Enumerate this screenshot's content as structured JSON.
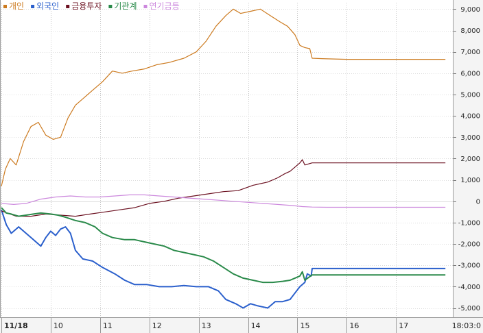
{
  "chart_data": {
    "type": "line",
    "legend": {
      "placement": "top-left",
      "entries": [
        {
          "name": "개인",
          "color": "#cc7a1f"
        },
        {
          "name": "외국인",
          "color": "#2a5fcc"
        },
        {
          "name": "금융투자",
          "color": "#6b1020"
        },
        {
          "name": "기관계",
          "color": "#2a8a4a"
        },
        {
          "name": "연기금등",
          "color": "#cc88dd"
        }
      ]
    },
    "yaxis": {
      "position": "right",
      "ylim": [
        -5400,
        9300
      ],
      "ticks": [
        9000,
        8000,
        7000,
        6000,
        5000,
        4000,
        3000,
        2000,
        1000,
        0,
        -1000,
        -2000,
        -3000,
        -4000,
        -5000
      ],
      "tick_labels": [
        "9,000",
        "8,000",
        "7,000",
        "6,000",
        "5,000",
        "4,000",
        "3,000",
        "2,000",
        "1,000",
        "0",
        "-1,000",
        "-2,000",
        "-3,000",
        "-4,000",
        "-5,000"
      ]
    },
    "xaxis": {
      "categories": [
        "11/18",
        "10",
        "11",
        "12",
        "13",
        "14",
        "15",
        "16",
        "17"
      ],
      "range": [
        0,
        9.15
      ],
      "time_label": "18:03:0"
    },
    "grid": true,
    "series": [
      {
        "name": "개인",
        "color": "#cc7a1f",
        "points": [
          [
            0,
            700
          ],
          [
            0.08,
            1500
          ],
          [
            0.18,
            2000
          ],
          [
            0.3,
            1700
          ],
          [
            0.45,
            2800
          ],
          [
            0.6,
            3500
          ],
          [
            0.75,
            3700
          ],
          [
            0.9,
            3100
          ],
          [
            1.05,
            2900
          ],
          [
            1.2,
            3000
          ],
          [
            1.35,
            3900
          ],
          [
            1.5,
            4500
          ],
          [
            1.65,
            4800
          ],
          [
            1.85,
            5200
          ],
          [
            2.05,
            5600
          ],
          [
            2.25,
            6100
          ],
          [
            2.45,
            6000
          ],
          [
            2.65,
            6100
          ],
          [
            2.9,
            6200
          ],
          [
            3.15,
            6400
          ],
          [
            3.4,
            6500
          ],
          [
            3.7,
            6700
          ],
          [
            3.95,
            7000
          ],
          [
            4.15,
            7500
          ],
          [
            4.35,
            8200
          ],
          [
            4.55,
            8700
          ],
          [
            4.7,
            9000
          ],
          [
            4.85,
            8800
          ],
          [
            5.05,
            8900
          ],
          [
            5.25,
            9000
          ],
          [
            5.45,
            8700
          ],
          [
            5.65,
            8400
          ],
          [
            5.8,
            8200
          ],
          [
            5.95,
            7800
          ],
          [
            6.05,
            7300
          ],
          [
            6.15,
            7200
          ],
          [
            6.25,
            7150
          ],
          [
            6.3,
            6700
          ],
          [
            6.5,
            6680
          ],
          [
            7.0,
            6650
          ],
          [
            8.0,
            6650
          ],
          [
            9.0,
            6650
          ]
        ]
      },
      {
        "name": "외국인",
        "color": "#2a5fcc",
        "points": [
          [
            0,
            -400
          ],
          [
            0.1,
            -1100
          ],
          [
            0.2,
            -1500
          ],
          [
            0.35,
            -1200
          ],
          [
            0.5,
            -1500
          ],
          [
            0.65,
            -1800
          ],
          [
            0.8,
            -2100
          ],
          [
            0.9,
            -1700
          ],
          [
            1.0,
            -1400
          ],
          [
            1.1,
            -1600
          ],
          [
            1.2,
            -1300
          ],
          [
            1.3,
            -1200
          ],
          [
            1.4,
            -1500
          ],
          [
            1.5,
            -2300
          ],
          [
            1.65,
            -2700
          ],
          [
            1.85,
            -2800
          ],
          [
            2.05,
            -3100
          ],
          [
            2.3,
            -3400
          ],
          [
            2.5,
            -3700
          ],
          [
            2.7,
            -3900
          ],
          [
            2.95,
            -3900
          ],
          [
            3.2,
            -4000
          ],
          [
            3.45,
            -4000
          ],
          [
            3.7,
            -3950
          ],
          [
            3.95,
            -4000
          ],
          [
            4.2,
            -4000
          ],
          [
            4.4,
            -4200
          ],
          [
            4.55,
            -4600
          ],
          [
            4.75,
            -4800
          ],
          [
            4.9,
            -5000
          ],
          [
            5.05,
            -4800
          ],
          [
            5.2,
            -4900
          ],
          [
            5.4,
            -5000
          ],
          [
            5.55,
            -4700
          ],
          [
            5.7,
            -4700
          ],
          [
            5.85,
            -4600
          ],
          [
            5.95,
            -4300
          ],
          [
            6.05,
            -4000
          ],
          [
            6.15,
            -3800
          ],
          [
            6.2,
            -3400
          ],
          [
            6.28,
            -3500
          ],
          [
            6.3,
            -3150
          ],
          [
            6.5,
            -3150
          ],
          [
            7.0,
            -3150
          ],
          [
            8.0,
            -3150
          ],
          [
            9.0,
            -3150
          ]
        ]
      },
      {
        "name": "금융투자",
        "color": "#6b1020",
        "points": [
          [
            0,
            -450
          ],
          [
            0.3,
            -700
          ],
          [
            0.6,
            -700
          ],
          [
            0.9,
            -600
          ],
          [
            1.2,
            -650
          ],
          [
            1.5,
            -700
          ],
          [
            1.8,
            -600
          ],
          [
            2.1,
            -500
          ],
          [
            2.4,
            -400
          ],
          [
            2.7,
            -300
          ],
          [
            3.0,
            -100
          ],
          [
            3.3,
            0
          ],
          [
            3.6,
            150
          ],
          [
            3.9,
            250
          ],
          [
            4.2,
            350
          ],
          [
            4.5,
            450
          ],
          [
            4.8,
            500
          ],
          [
            5.1,
            750
          ],
          [
            5.4,
            900
          ],
          [
            5.6,
            1100
          ],
          [
            5.75,
            1300
          ],
          [
            5.85,
            1400
          ],
          [
            5.95,
            1600
          ],
          [
            6.05,
            1800
          ],
          [
            6.1,
            1950
          ],
          [
            6.15,
            1700
          ],
          [
            6.3,
            1800
          ],
          [
            6.5,
            1800
          ],
          [
            7.0,
            1800
          ],
          [
            8.0,
            1800
          ],
          [
            9.0,
            1800
          ]
        ]
      },
      {
        "name": "기관계",
        "color": "#2a8a4a",
        "points": [
          [
            0,
            -300
          ],
          [
            0.1,
            -550
          ],
          [
            0.2,
            -600
          ],
          [
            0.35,
            -700
          ],
          [
            0.5,
            -650
          ],
          [
            0.65,
            -600
          ],
          [
            0.8,
            -550
          ],
          [
            1.0,
            -600
          ],
          [
            1.15,
            -650
          ],
          [
            1.3,
            -750
          ],
          [
            1.5,
            -900
          ],
          [
            1.7,
            -1000
          ],
          [
            1.9,
            -1200
          ],
          [
            2.05,
            -1500
          ],
          [
            2.25,
            -1700
          ],
          [
            2.5,
            -1800
          ],
          [
            2.7,
            -1800
          ],
          [
            2.9,
            -1900
          ],
          [
            3.1,
            -2000
          ],
          [
            3.3,
            -2100
          ],
          [
            3.5,
            -2300
          ],
          [
            3.7,
            -2400
          ],
          [
            3.9,
            -2500
          ],
          [
            4.1,
            -2600
          ],
          [
            4.3,
            -2800
          ],
          [
            4.5,
            -3100
          ],
          [
            4.7,
            -3400
          ],
          [
            4.9,
            -3600
          ],
          [
            5.1,
            -3700
          ],
          [
            5.3,
            -3800
          ],
          [
            5.5,
            -3800
          ],
          [
            5.7,
            -3750
          ],
          [
            5.85,
            -3700
          ],
          [
            5.95,
            -3600
          ],
          [
            6.05,
            -3500
          ],
          [
            6.1,
            -3300
          ],
          [
            6.15,
            -3700
          ],
          [
            6.3,
            -3450
          ],
          [
            6.5,
            -3450
          ],
          [
            7.0,
            -3450
          ],
          [
            8.0,
            -3450
          ],
          [
            9.0,
            -3450
          ]
        ]
      },
      {
        "name": "연기금등",
        "color": "#cc88dd",
        "points": [
          [
            0,
            -100
          ],
          [
            0.25,
            -150
          ],
          [
            0.5,
            -100
          ],
          [
            0.8,
            100
          ],
          [
            1.1,
            200
          ],
          [
            1.4,
            250
          ],
          [
            1.7,
            200
          ],
          [
            2.0,
            200
          ],
          [
            2.3,
            250
          ],
          [
            2.6,
            300
          ],
          [
            2.9,
            300
          ],
          [
            3.2,
            250
          ],
          [
            3.5,
            200
          ],
          [
            3.8,
            150
          ],
          [
            4.1,
            100
          ],
          [
            4.4,
            50
          ],
          [
            4.7,
            0
          ],
          [
            5.0,
            -50
          ],
          [
            5.3,
            -100
          ],
          [
            5.6,
            -150
          ],
          [
            5.9,
            -200
          ],
          [
            6.1,
            -250
          ],
          [
            6.3,
            -270
          ],
          [
            6.6,
            -280
          ],
          [
            7.0,
            -280
          ],
          [
            8.0,
            -280
          ],
          [
            9.0,
            -280
          ]
        ]
      }
    ]
  }
}
